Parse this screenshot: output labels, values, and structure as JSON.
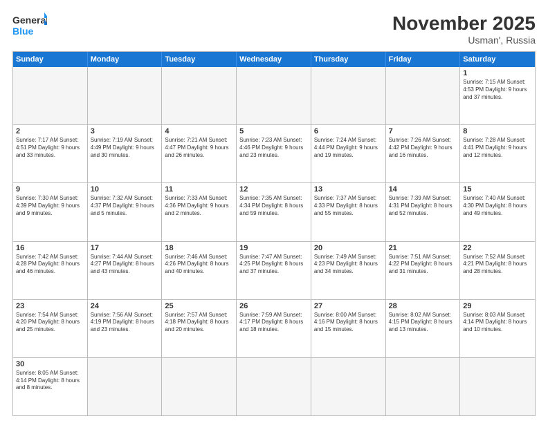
{
  "header": {
    "logo_general": "General",
    "logo_blue": "Blue",
    "month_year": "November 2025",
    "location": "Usman', Russia"
  },
  "weekdays": [
    "Sunday",
    "Monday",
    "Tuesday",
    "Wednesday",
    "Thursday",
    "Friday",
    "Saturday"
  ],
  "weeks": [
    [
      {
        "day": "",
        "info": ""
      },
      {
        "day": "",
        "info": ""
      },
      {
        "day": "",
        "info": ""
      },
      {
        "day": "",
        "info": ""
      },
      {
        "day": "",
        "info": ""
      },
      {
        "day": "",
        "info": ""
      },
      {
        "day": "1",
        "info": "Sunrise: 7:15 AM\nSunset: 4:53 PM\nDaylight: 9 hours\nand 37 minutes."
      }
    ],
    [
      {
        "day": "2",
        "info": "Sunrise: 7:17 AM\nSunset: 4:51 PM\nDaylight: 9 hours\nand 33 minutes."
      },
      {
        "day": "3",
        "info": "Sunrise: 7:19 AM\nSunset: 4:49 PM\nDaylight: 9 hours\nand 30 minutes."
      },
      {
        "day": "4",
        "info": "Sunrise: 7:21 AM\nSunset: 4:47 PM\nDaylight: 9 hours\nand 26 minutes."
      },
      {
        "day": "5",
        "info": "Sunrise: 7:23 AM\nSunset: 4:46 PM\nDaylight: 9 hours\nand 23 minutes."
      },
      {
        "day": "6",
        "info": "Sunrise: 7:24 AM\nSunset: 4:44 PM\nDaylight: 9 hours\nand 19 minutes."
      },
      {
        "day": "7",
        "info": "Sunrise: 7:26 AM\nSunset: 4:42 PM\nDaylight: 9 hours\nand 16 minutes."
      },
      {
        "day": "8",
        "info": "Sunrise: 7:28 AM\nSunset: 4:41 PM\nDaylight: 9 hours\nand 12 minutes."
      }
    ],
    [
      {
        "day": "9",
        "info": "Sunrise: 7:30 AM\nSunset: 4:39 PM\nDaylight: 9 hours\nand 9 minutes."
      },
      {
        "day": "10",
        "info": "Sunrise: 7:32 AM\nSunset: 4:37 PM\nDaylight: 9 hours\nand 5 minutes."
      },
      {
        "day": "11",
        "info": "Sunrise: 7:33 AM\nSunset: 4:36 PM\nDaylight: 9 hours\nand 2 minutes."
      },
      {
        "day": "12",
        "info": "Sunrise: 7:35 AM\nSunset: 4:34 PM\nDaylight: 8 hours\nand 59 minutes."
      },
      {
        "day": "13",
        "info": "Sunrise: 7:37 AM\nSunset: 4:33 PM\nDaylight: 8 hours\nand 55 minutes."
      },
      {
        "day": "14",
        "info": "Sunrise: 7:39 AM\nSunset: 4:31 PM\nDaylight: 8 hours\nand 52 minutes."
      },
      {
        "day": "15",
        "info": "Sunrise: 7:40 AM\nSunset: 4:30 PM\nDaylight: 8 hours\nand 49 minutes."
      }
    ],
    [
      {
        "day": "16",
        "info": "Sunrise: 7:42 AM\nSunset: 4:28 PM\nDaylight: 8 hours\nand 46 minutes."
      },
      {
        "day": "17",
        "info": "Sunrise: 7:44 AM\nSunset: 4:27 PM\nDaylight: 8 hours\nand 43 minutes."
      },
      {
        "day": "18",
        "info": "Sunrise: 7:46 AM\nSunset: 4:26 PM\nDaylight: 8 hours\nand 40 minutes."
      },
      {
        "day": "19",
        "info": "Sunrise: 7:47 AM\nSunset: 4:25 PM\nDaylight: 8 hours\nand 37 minutes."
      },
      {
        "day": "20",
        "info": "Sunrise: 7:49 AM\nSunset: 4:23 PM\nDaylight: 8 hours\nand 34 minutes."
      },
      {
        "day": "21",
        "info": "Sunrise: 7:51 AM\nSunset: 4:22 PM\nDaylight: 8 hours\nand 31 minutes."
      },
      {
        "day": "22",
        "info": "Sunrise: 7:52 AM\nSunset: 4:21 PM\nDaylight: 8 hours\nand 28 minutes."
      }
    ],
    [
      {
        "day": "23",
        "info": "Sunrise: 7:54 AM\nSunset: 4:20 PM\nDaylight: 8 hours\nand 25 minutes."
      },
      {
        "day": "24",
        "info": "Sunrise: 7:56 AM\nSunset: 4:19 PM\nDaylight: 8 hours\nand 23 minutes."
      },
      {
        "day": "25",
        "info": "Sunrise: 7:57 AM\nSunset: 4:18 PM\nDaylight: 8 hours\nand 20 minutes."
      },
      {
        "day": "26",
        "info": "Sunrise: 7:59 AM\nSunset: 4:17 PM\nDaylight: 8 hours\nand 18 minutes."
      },
      {
        "day": "27",
        "info": "Sunrise: 8:00 AM\nSunset: 4:16 PM\nDaylight: 8 hours\nand 15 minutes."
      },
      {
        "day": "28",
        "info": "Sunrise: 8:02 AM\nSunset: 4:15 PM\nDaylight: 8 hours\nand 13 minutes."
      },
      {
        "day": "29",
        "info": "Sunrise: 8:03 AM\nSunset: 4:14 PM\nDaylight: 8 hours\nand 10 minutes."
      }
    ],
    [
      {
        "day": "30",
        "info": "Sunrise: 8:05 AM\nSunset: 4:14 PM\nDaylight: 8 hours\nand 8 minutes."
      },
      {
        "day": "",
        "info": ""
      },
      {
        "day": "",
        "info": ""
      },
      {
        "day": "",
        "info": ""
      },
      {
        "day": "",
        "info": ""
      },
      {
        "day": "",
        "info": ""
      },
      {
        "day": "",
        "info": ""
      }
    ]
  ]
}
